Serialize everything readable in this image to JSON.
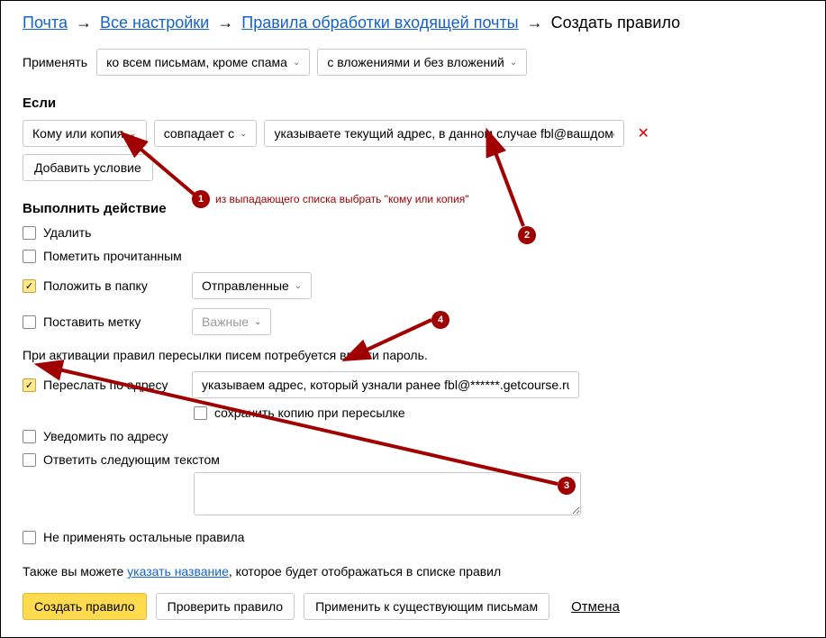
{
  "breadcrumb": {
    "mail": "Почта",
    "settings": "Все настройки",
    "rules": "Правила обработки входящей почты",
    "current": "Создать правило"
  },
  "apply": {
    "label": "Применять",
    "filter1": "ко всем письмам, кроме спама",
    "filter2": "с вложениями и без вложений"
  },
  "if": {
    "title": "Если",
    "field": "Кому или копия",
    "op": "совпадает с",
    "value": "указываете текущий адрес, в данном случае fbl@вашдомен",
    "add": "Добавить условие"
  },
  "action": {
    "title": "Выполнить действие",
    "delete": "Удалить",
    "markread": "Пометить прочитанным",
    "putfolder": "Положить в папку",
    "folder_value": "Отправленные",
    "setlabel": "Поставить метку",
    "label_value": "Важные"
  },
  "forward": {
    "note": "При активации правил пересылки писем потребуется ввести пароль.",
    "forward_label": "Переслать по адресу",
    "forward_value": "указываем адрес, который узнали ранее fbl@******.getcourse.ru",
    "keep_copy": "сохранить копию при пересылке",
    "notify_label": "Уведомить по адресу",
    "reply_label": "Ответить следующим текстом",
    "stop_rules": "Не применять остальные правила"
  },
  "footer": {
    "note_pre": "Также вы можете ",
    "note_link": "указать название",
    "note_post": ", которое будет отображаться в списке правил",
    "create": "Создать правило",
    "check": "Проверить правило",
    "apply_existing": "Применить к существующим письмам",
    "cancel": "Отмена"
  },
  "annotations": {
    "a1": "1",
    "a2": "2",
    "a3": "3",
    "a4": "4",
    "a1_text": "из выпадающего списка выбрать \"кому или копия\""
  }
}
